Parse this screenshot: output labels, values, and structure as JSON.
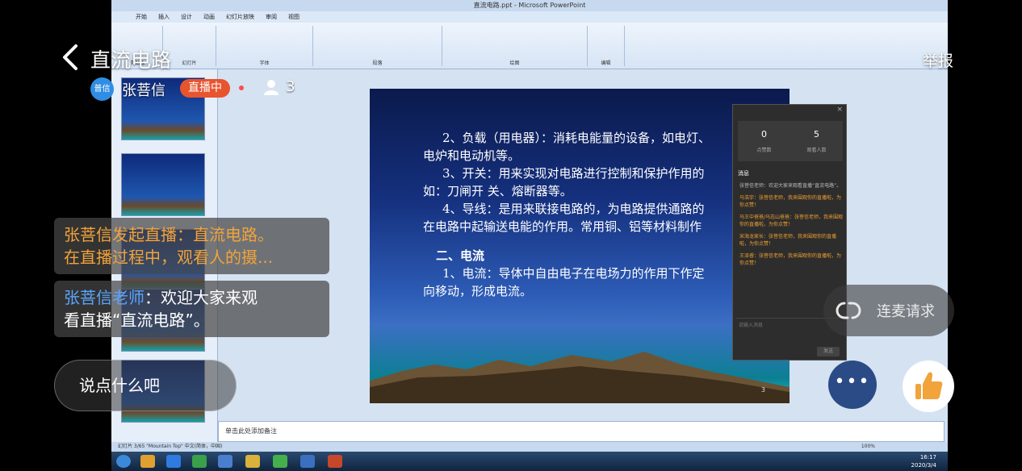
{
  "header": {
    "title": "直流电路",
    "report_label": "举报"
  },
  "host": {
    "avatar_text": "普信",
    "name": "张菩信",
    "live_badge": "直播中",
    "viewer_count": "3"
  },
  "comments": [
    {
      "line1": "张菩信发起直播：直流电路。",
      "line2": "在直播过程中，观看人的摄..."
    },
    {
      "author": "张菩信老师",
      "text1": "：欢迎大家来观",
      "text2": "看直播“直流电路”。"
    }
  ],
  "chat_input": {
    "placeholder": "说点什么吧"
  },
  "mic_request": {
    "label": "连麦请求"
  },
  "slide": {
    "lines": [
      "2、负载（用电器）：消耗电能量的设备，如电灯、",
      "电炉和电动机等。",
      "3、开关：用来实现对电路进行控制和保护作用的",
      "如：刀闸开 关、熔断器等。",
      "4、导线：是用来联接电路的，为电路提供通路的",
      "在电路中起输送电能的作用。常用铜、铝等材料制作"
    ],
    "heading": "二、电流",
    "lines2": [
      "1、电流：导体中自由电子在电场力的作用下作定",
      "向移动，形成电流。"
    ],
    "page_number": "3"
  },
  "stats_panel": {
    "likes": "0",
    "likes_label": "点赞数",
    "viewers": "5",
    "viewers_label": "观看人数",
    "messages_title": "消息",
    "system_message": "张菩信老师：欢迎大家来观看直播“直流电路”。",
    "gift_messages": [
      "马浩宇：张菩信老师，我来围观你的直播啦，为你点赞！",
      "马王中爸爸/马志山爸爸：张菩信老师，我来围观你的直播啦，为你点赞！",
      "宋海龙家长：张菩信老师，我来围观你的直播啦，为你点赞！",
      "王泽睿：张菩信老师，我来围观你的直播啦，为你点赞！"
    ],
    "input_placeholder": "说输入消息",
    "send_label": "发送"
  },
  "powerpoint": {
    "window_title": "直流电路.ppt - Microsoft PowerPoint",
    "tabs": [
      "开始",
      "插入",
      "设计",
      "动画",
      "幻灯片放映",
      "审阅",
      "视图"
    ],
    "groups": [
      "剪贴板",
      "幻灯片",
      "字体",
      "段落",
      "绘图",
      "编辑"
    ],
    "notes_placeholder": "单击此处添加备注",
    "status": "幻灯片 3/65   \"Mountain Top\"   中文(简体，中国)",
    "zoom": "100%",
    "clock_time": "16:17",
    "clock_date": "2020/3/4"
  },
  "colors": {
    "live_badge": "#e8542e",
    "comment_highlight": "#f2a33a",
    "author_blue": "#5aa6ff",
    "more_button": "#2b4b86",
    "like_icon": "#f2a33a"
  },
  "icons": {
    "back": "chevron-left-icon",
    "viewer": "user-icon",
    "mic": "link-icon",
    "more": "more-dots-icon",
    "like": "thumbs-up-icon"
  }
}
